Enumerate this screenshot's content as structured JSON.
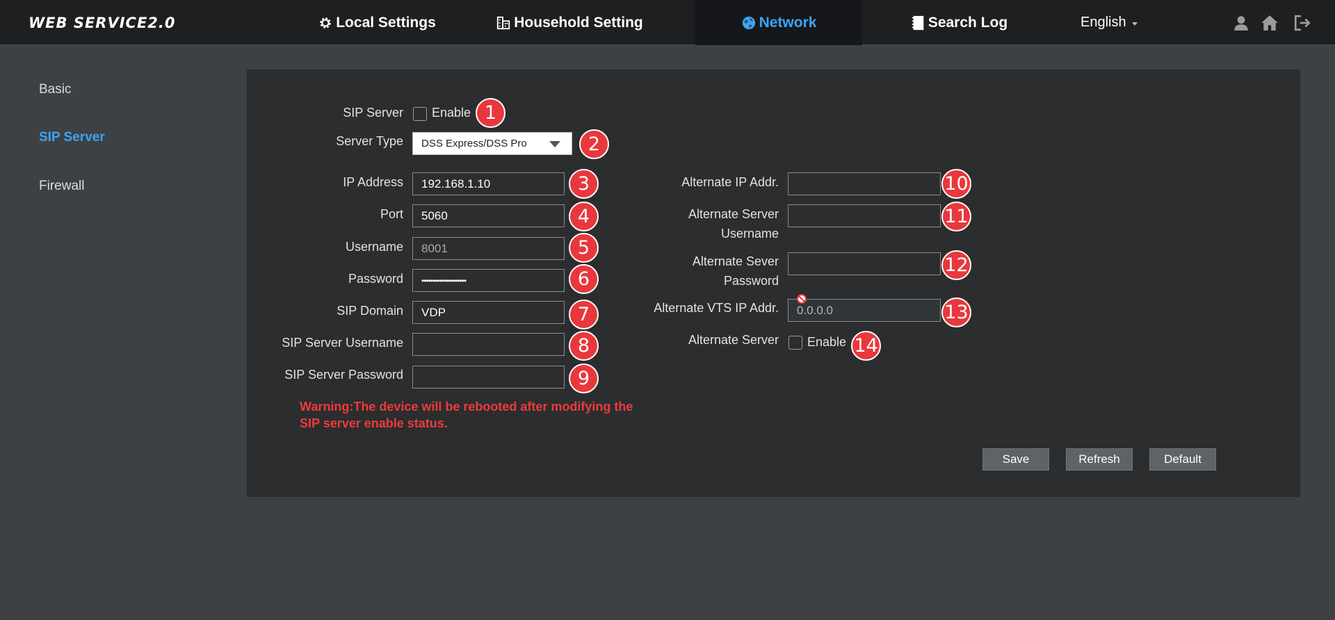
{
  "app": {
    "logo": "WEB SERVICE2.0"
  },
  "nav": {
    "local_settings": "Local Settings",
    "household_setting": "Household Setting",
    "network": "Network",
    "search_log": "Search Log",
    "active": "Network"
  },
  "language": {
    "selected": "English"
  },
  "top_icons": [
    "user-icon",
    "home-icon",
    "logout-icon"
  ],
  "sidebar": {
    "items": [
      {
        "label": "Basic"
      },
      {
        "label": "SIP Server",
        "active": true
      },
      {
        "label": "Firewall"
      }
    ]
  },
  "form": {
    "sip_server": {
      "label": "SIP Server",
      "checkbox_label": "Enable",
      "checked": false
    },
    "server_type": {
      "label": "Server Type",
      "value": "DSS Express/DSS Pro"
    },
    "ip_address": {
      "label": "IP Address",
      "value": "192.168.1.10"
    },
    "port": {
      "label": "Port",
      "value": "5060"
    },
    "username": {
      "label": "Username",
      "value": "8001"
    },
    "password": {
      "label": "Password",
      "value": "••••••••••••••••••••"
    },
    "sip_domain": {
      "label": "SIP Domain",
      "value": "VDP"
    },
    "sip_server_username": {
      "label": "SIP Server Username",
      "value": ""
    },
    "sip_server_password": {
      "label": "SIP Server Password",
      "value": ""
    },
    "alt_ip": {
      "label": "Alternate IP Addr.",
      "value": ""
    },
    "alt_server_username": {
      "label_line1": "Alternate Server",
      "label_line2": "Username",
      "value": ""
    },
    "alt_server_password": {
      "label_line1": "Alternate Sever",
      "label_line2": "Password",
      "value": ""
    },
    "alt_vts_ip": {
      "label": "Alternate VTS IP Addr.",
      "value": "0.0.0.0"
    },
    "alt_server": {
      "label": "Alternate Server",
      "checkbox_label": "Enable",
      "checked": false
    },
    "warning_line1": "Warning:The device will be rebooted after modifying the",
    "warning_line2": "SIP server enable status."
  },
  "badges": [
    "1",
    "2",
    "3",
    "4",
    "5",
    "6",
    "7",
    "8",
    "9",
    "10",
    "11",
    "12",
    "13",
    "14"
  ],
  "buttons": {
    "save": "Save",
    "refresh": "Refresh",
    "default": "Default"
  },
  "colors": {
    "accent": "#3ea3f4",
    "badge": "#e8383d",
    "warning": "#ef3a3a"
  }
}
